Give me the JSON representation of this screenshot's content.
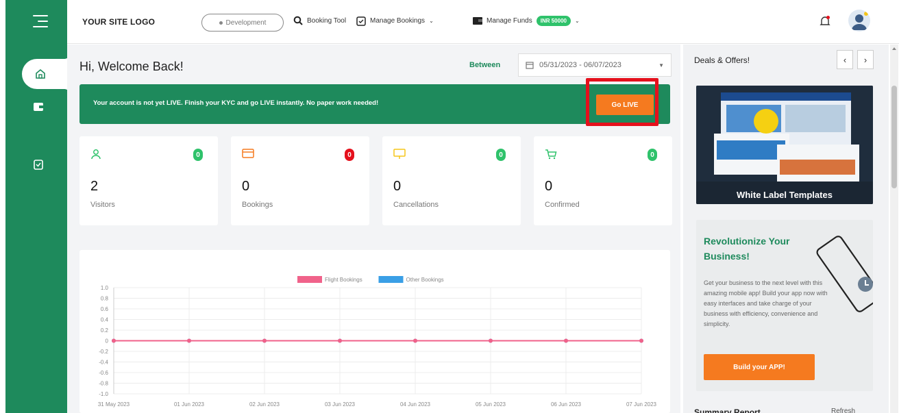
{
  "header": {
    "logo_text": "YOUR SITE LOGO",
    "environment": "Development",
    "booking_tool": "Booking Tool",
    "manage_bookings": "Manage Bookings",
    "manage_funds": "Manage Funds",
    "funds_balance": "INR 50000"
  },
  "sidebar": {
    "items": [
      {
        "icon": "home-icon",
        "active": true
      },
      {
        "icon": "wallet-icon",
        "active": false
      },
      {
        "icon": "bookings-icon",
        "active": false
      }
    ]
  },
  "dashboard": {
    "greeting": "Hi, Welcome Back!",
    "between_label": "Between",
    "date_range": "05/31/2023 - 06/07/2023",
    "kyc_message": "Your account is not yet LIVE. Finish your KYC and go LIVE instantly. No paper work needed!",
    "go_live_label": "Go LIVE",
    "stats": [
      {
        "label": "Visitors",
        "value": "2",
        "badge": "0",
        "badge_color": "#2fc26b",
        "icon": "user-icon",
        "icon_color": "#2fc26b"
      },
      {
        "label": "Bookings",
        "value": "0",
        "badge": "0",
        "badge_color": "#e5101c",
        "icon": "card-icon",
        "icon_color": "#f57a1f"
      },
      {
        "label": "Cancellations",
        "value": "0",
        "badge": "0",
        "badge_color": "#2fc26b",
        "icon": "monitor-icon",
        "icon_color": "#f5c518"
      },
      {
        "label": "Confirmed",
        "value": "0",
        "badge": "0",
        "badge_color": "#2fc26b",
        "icon": "cart-icon",
        "icon_color": "#2fc26b"
      }
    ]
  },
  "chart_data": {
    "type": "line",
    "title": "",
    "xlabel": "",
    "ylabel": "",
    "x": [
      "31 May 2023",
      "01 Jun 2023",
      "02 Jun 2023",
      "03 Jun 2023",
      "04 Jun 2023",
      "05 Jun 2023",
      "06 Jun 2023",
      "07 Jun 2023"
    ],
    "yticks": [
      "1.0",
      "0.8",
      "0.6",
      "0.4",
      "0.2",
      "0",
      "-0.2",
      "-0.4",
      "-0.6",
      "-0.8",
      "-1.0"
    ],
    "ylim": [
      -1.0,
      1.0
    ],
    "legend_position": "top-center",
    "grid": true,
    "series": [
      {
        "name": "Flight Bookings",
        "color": "#f0628a",
        "values": [
          0,
          0,
          0,
          0,
          0,
          0,
          0,
          0
        ]
      },
      {
        "name": "Other Bookings",
        "color": "#3a9fe6",
        "values": [
          0,
          0,
          0,
          0,
          0,
          0,
          0,
          0
        ]
      }
    ]
  },
  "rail": {
    "deals_title": "Deals & Offers!",
    "prev": "‹",
    "next": "›",
    "promo_label": "White Label Templates",
    "app_title": "Revolutionize Your Business!",
    "app_desc": "Get your business to the next level with this amazing mobile app! Build your app now with easy interfaces and take charge of your business with efficiency, convenience and simplicity.",
    "app_button": "Build your APP!",
    "summary_title": "Summary Report",
    "summary_action": "Refresh"
  },
  "colors": {
    "sidebar_green": "#1e8a5c",
    "accent_orange": "#f57a1f",
    "highlight_red": "#e5101c"
  }
}
